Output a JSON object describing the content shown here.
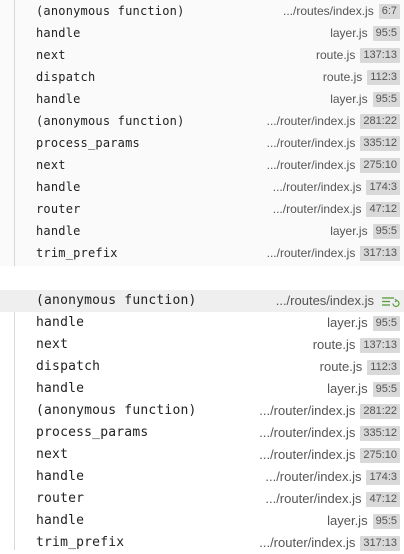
{
  "top_stack": [
    {
      "fn": "(anonymous function)",
      "file": ".../routes/index.js",
      "pos": "6:7"
    },
    {
      "fn": "handle",
      "file": "layer.js",
      "pos": "95:5"
    },
    {
      "fn": "next",
      "file": "route.js",
      "pos": "137:13"
    },
    {
      "fn": "dispatch",
      "file": "route.js",
      "pos": "112:3"
    },
    {
      "fn": "handle",
      "file": "layer.js",
      "pos": "95:5"
    },
    {
      "fn": "(anonymous function)",
      "file": ".../router/index.js",
      "pos": "281:22"
    },
    {
      "fn": "process_params",
      "file": ".../router/index.js",
      "pos": "335:12"
    },
    {
      "fn": "next",
      "file": ".../router/index.js",
      "pos": "275:10"
    },
    {
      "fn": "handle",
      "file": ".../router/index.js",
      "pos": "174:3"
    },
    {
      "fn": "router",
      "file": ".../router/index.js",
      "pos": "47:12"
    },
    {
      "fn": "handle",
      "file": "layer.js",
      "pos": "95:5"
    },
    {
      "fn": "trim_prefix",
      "file": ".../router/index.js",
      "pos": "317:13"
    }
  ],
  "bottom_stack": [
    {
      "fn": "(anonymous function)",
      "file": ".../routes/index.js",
      "pos": "",
      "icon": "step-list-icon"
    },
    {
      "fn": "handle",
      "file": "layer.js",
      "pos": "95:5"
    },
    {
      "fn": "next",
      "file": "route.js",
      "pos": "137:13"
    },
    {
      "fn": "dispatch",
      "file": "route.js",
      "pos": "112:3"
    },
    {
      "fn": "handle",
      "file": "layer.js",
      "pos": "95:5"
    },
    {
      "fn": "(anonymous function)",
      "file": ".../router/index.js",
      "pos": "281:22"
    },
    {
      "fn": "process_params",
      "file": ".../router/index.js",
      "pos": "335:12"
    },
    {
      "fn": "next",
      "file": ".../router/index.js",
      "pos": "275:10"
    },
    {
      "fn": "handle",
      "file": ".../router/index.js",
      "pos": "174:3"
    },
    {
      "fn": "router",
      "file": ".../router/index.js",
      "pos": "47:12"
    },
    {
      "fn": "handle",
      "file": "layer.js",
      "pos": "95:5"
    },
    {
      "fn": "trim_prefix",
      "file": ".../router/index.js",
      "pos": "317:13"
    }
  ],
  "colors": {
    "badge_bg": "#d9d9d9",
    "icon_green": "#5a9a3a"
  }
}
